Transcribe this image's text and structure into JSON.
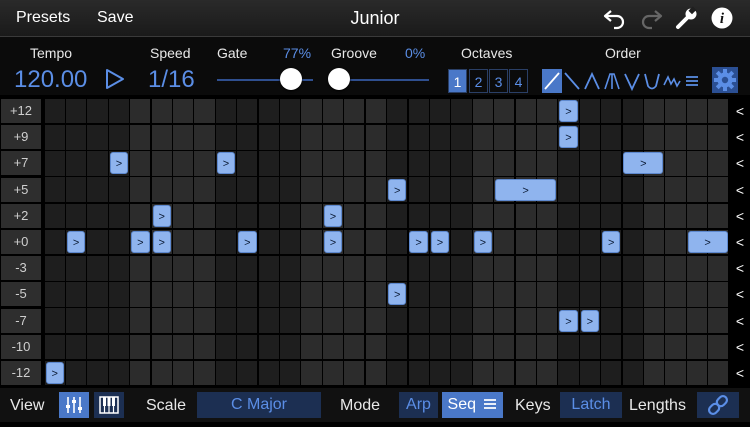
{
  "header": {
    "presets_label": "Presets",
    "save_label": "Save",
    "title": "Junior",
    "icons": [
      "undo-icon",
      "redo-icon",
      "wrench-icon",
      "info-icon"
    ]
  },
  "controls": {
    "tempo_label": "Tempo",
    "tempo_value": "120.00",
    "speed_label": "Speed",
    "speed_value": "1/16",
    "gate_label": "Gate",
    "gate_value": "77%",
    "gate_level": 0.77,
    "groove_label": "Groove",
    "groove_value": "0%",
    "groove_level": 0.0,
    "octaves_label": "Octaves",
    "octaves": [
      "1",
      "2",
      "3",
      "4"
    ],
    "octave_selected": "1",
    "order_label": "Order",
    "order_icons": [
      "order-up-icon",
      "order-down-icon",
      "order-up-down-icon",
      "order-up-down-repeat-icon",
      "order-down-up-icon",
      "order-down-up-repeat-icon",
      "order-random-icon",
      "order-chord-icon"
    ],
    "order_selected": 0
  },
  "sequencer": {
    "rows": [
      "+12",
      "+9",
      "+7",
      "+5",
      "+2",
      "+0",
      "-3",
      "-5",
      "-7",
      "-10",
      "-12"
    ],
    "row_arrow": "<",
    "step_count": 32,
    "note_glyph": ">",
    "notes": [
      {
        "row": "+12",
        "step": 24,
        "length": 1
      },
      {
        "row": "+9",
        "step": 24,
        "length": 1
      },
      {
        "row": "+7",
        "step": 3,
        "length": 1
      },
      {
        "row": "+7",
        "step": 8,
        "length": 1
      },
      {
        "row": "+7",
        "step": 27,
        "length": 2
      },
      {
        "row": "+5",
        "step": 16,
        "length": 1
      },
      {
        "row": "+5",
        "step": 21,
        "length": 3
      },
      {
        "row": "+2",
        "step": 5,
        "length": 1
      },
      {
        "row": "+2",
        "step": 13,
        "length": 1
      },
      {
        "row": "+0",
        "step": 1,
        "length": 1
      },
      {
        "row": "+0",
        "step": 4,
        "length": 1
      },
      {
        "row": "+0",
        "step": 5,
        "length": 1
      },
      {
        "row": "+0",
        "step": 9,
        "length": 1
      },
      {
        "row": "+0",
        "step": 13,
        "length": 1
      },
      {
        "row": "+0",
        "step": 17,
        "length": 1
      },
      {
        "row": "+0",
        "step": 18,
        "length": 1
      },
      {
        "row": "+0",
        "step": 20,
        "length": 1
      },
      {
        "row": "+0",
        "step": 26,
        "length": 1
      },
      {
        "row": "+0",
        "step": 30,
        "length": 2
      },
      {
        "row": "-5",
        "step": 16,
        "length": 1
      },
      {
        "row": "-7",
        "step": 24,
        "length": 1
      },
      {
        "row": "-7",
        "step": 25,
        "length": 1
      },
      {
        "row": "-12",
        "step": 0,
        "length": 1
      }
    ]
  },
  "footer": {
    "view_label": "View",
    "view_icons": [
      "mixer-icon",
      "piano-icon"
    ],
    "scale_label": "Scale",
    "scale_value": "C Major",
    "mode_label": "Mode",
    "mode_arp": "Arp",
    "mode_seq": "Seq",
    "mode_selected": "Seq",
    "keys_label": "Keys",
    "latch_label": "Latch",
    "lengths_label": "Lengths",
    "link_icon": "link-icon"
  },
  "colors": {
    "accent": "#5b8ee6",
    "accent_selected": "#4a78c8",
    "note_fill": "#8fb4ee",
    "background": "#000000"
  }
}
